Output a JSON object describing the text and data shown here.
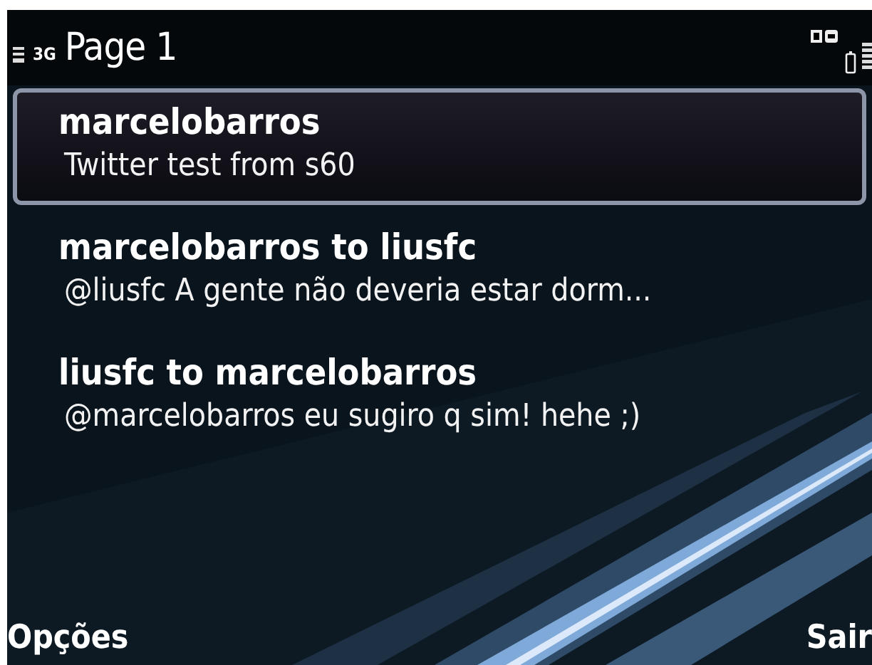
{
  "status_bar": {
    "network": "3G",
    "title": "Page 1"
  },
  "messages": [
    {
      "title": "marcelobarros",
      "text": "Twitter test from s60",
      "selected": true
    },
    {
      "title": "marcelobarros to liusfc",
      "text": "@liusfc A gente não deveria estar dorm...",
      "selected": false
    },
    {
      "title": "liusfc to marcelobarros",
      "text": "@marcelobarros eu sugiro q sim! hehe ;)",
      "selected": false
    }
  ],
  "softkeys": {
    "left": "Opções",
    "right": "Sair"
  }
}
